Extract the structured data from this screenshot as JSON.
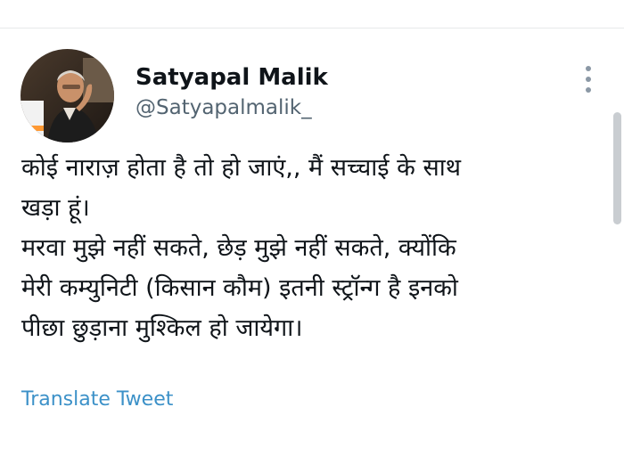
{
  "tweet": {
    "author": {
      "display_name": "Satyapal Malik",
      "handle": "@Satyapalmalik_"
    },
    "text_lines": [
      "कोई नाराज़ होता है तो हो जाएं,, मैं सच्चाई के साथ",
      "खड़ा हूं।",
      "मरवा मुझे नहीं सकते, छेड़ मुझे नहीं सकते, क्योंकि",
      "मेरी कम्युनिटी (किसान कौम) इतनी स्ट्रॉन्ग है इनको",
      "पीछा छुड़ाना मुश्किल हो जायेगा।"
    ],
    "translate_label": "Translate Tweet"
  },
  "icons": {
    "more": "more-vertical-icon"
  },
  "colors": {
    "text": "#0f1419",
    "secondary_text": "#536471",
    "link": "#3c91c8",
    "background": "#ffffff"
  }
}
